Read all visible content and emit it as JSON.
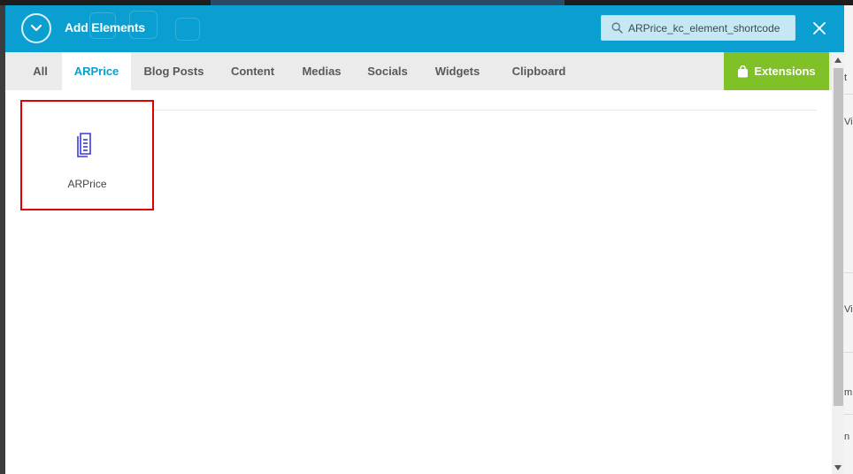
{
  "header": {
    "title": "Add Elements",
    "collapse_icon": "chevron-down-icon",
    "close_icon": "close-icon",
    "bg_color": "#0a9fd0"
  },
  "search": {
    "value": "ARPrice_kc_element_shortcode",
    "icon": "search-icon"
  },
  "tabs": [
    {
      "label": "All",
      "active": false
    },
    {
      "label": "ARPrice",
      "active": true
    },
    {
      "label": "Blog Posts",
      "active": false
    },
    {
      "label": "Content",
      "active": false
    },
    {
      "label": "Medias",
      "active": false
    },
    {
      "label": "Socials",
      "active": false
    },
    {
      "label": "Widgets",
      "active": false
    },
    {
      "label": "Clipboard",
      "active": false
    }
  ],
  "extensions_button": {
    "label": "Extensions",
    "icon": "shopping-bag-icon",
    "color": "#7fc127"
  },
  "elements": [
    {
      "label": "ARPrice",
      "icon": "document-copy-icon",
      "icon_color": "#3b3bd6",
      "highlight_color": "#e00000"
    }
  ],
  "background_fragments": [
    "t",
    "Vis",
    "Vis",
    "m",
    "n"
  ]
}
